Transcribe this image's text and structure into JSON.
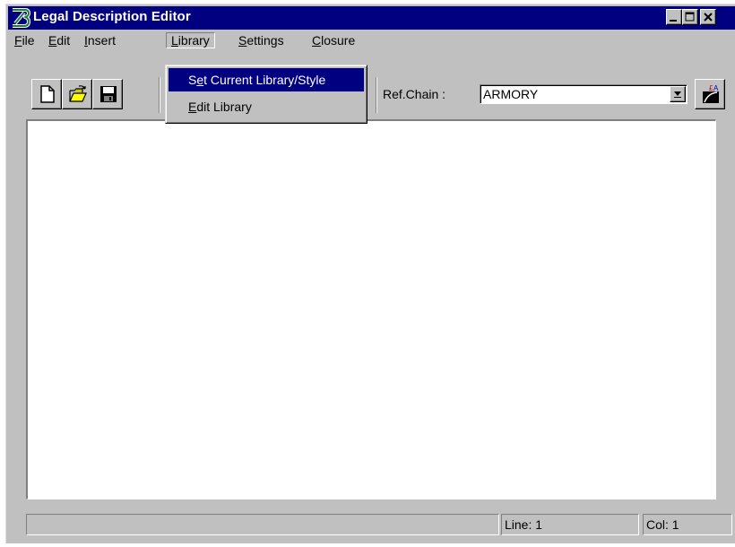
{
  "window": {
    "title": "Legal Description Editor",
    "logo_icon": "bentley-b-logo-icon",
    "controls": [
      "minimize-icon",
      "maximize-icon",
      "close-icon"
    ]
  },
  "menubar": {
    "items": [
      {
        "label": "File",
        "mnemonic": "F"
      },
      {
        "label": "Edit",
        "mnemonic": "E"
      },
      {
        "label": "Insert",
        "mnemonic": "I"
      },
      {
        "label": "Library",
        "mnemonic": "L",
        "open": true
      },
      {
        "label": "Settings",
        "mnemonic": "S"
      },
      {
        "label": "Closure",
        "mnemonic": "C"
      }
    ]
  },
  "library_menu": {
    "items": [
      {
        "label": "Set Current Library/Style",
        "highlighted": true
      },
      {
        "label": "Edit Library",
        "highlighted": false
      }
    ]
  },
  "toolbar": {
    "buttons": [
      "new-document-icon",
      "open-folder-icon",
      "save-disk-icon"
    ],
    "refchain_label": "Ref.Chain :",
    "refchain_value": "ARMORY",
    "draw_button_icon": "draw-chain-icon"
  },
  "editor": {
    "content": ""
  },
  "statusbar": {
    "message": "",
    "line": "Line: 1",
    "col": "Col: 1"
  },
  "colors": {
    "title_bar": "#000080",
    "face": "#c0c0c0",
    "highlight": "#000080"
  }
}
